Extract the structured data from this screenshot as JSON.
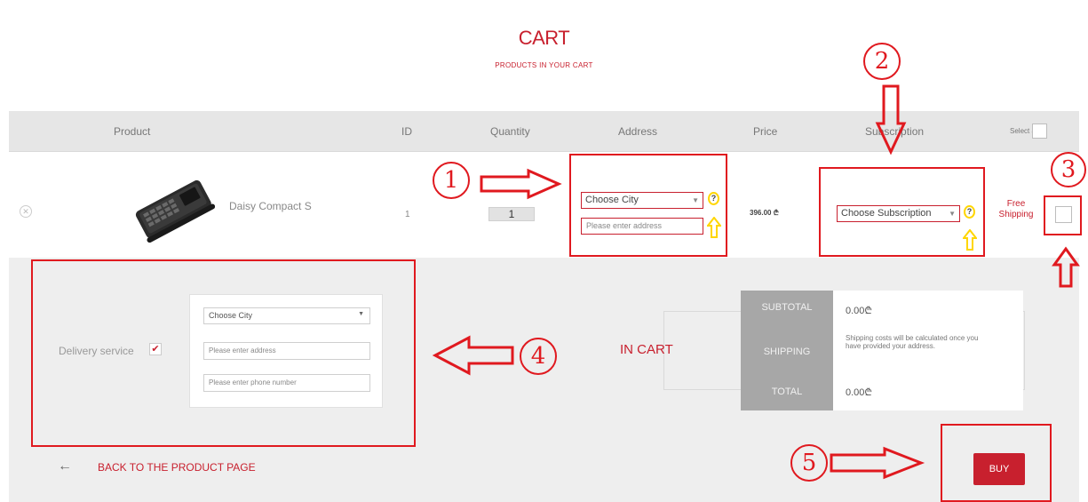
{
  "header": {
    "title": "CART",
    "subtitle": "PRODUCTS IN YOUR CART"
  },
  "table": {
    "columns": [
      "Product",
      "ID",
      "Quantity",
      "Address",
      "Price",
      "Subscription"
    ],
    "select_all_label": "Select all"
  },
  "row": {
    "product_name": "Daisy Compact S",
    "id": "1",
    "quantity": "1",
    "address": {
      "city_value": "Choose City",
      "address_placeholder": "Please enter address"
    },
    "price": "396.00 ₾",
    "subscription_value": "Choose Subscription",
    "help_glyph": "?",
    "free_shipping_label": "Free Shipping"
  },
  "delivery": {
    "label": "Delivery service",
    "city_value": "Choose City",
    "address_placeholder": "Please enter address",
    "phone_placeholder": "Please enter phone number"
  },
  "totals": {
    "in_cart_label": "IN CART",
    "subtotal_label": "SUBTOTAL",
    "subtotal_value": "0.00₾",
    "shipping_label": "SHIPPING",
    "shipping_note": "Shipping costs will be calculated once you have provided your address.",
    "total_label": "TOTAL",
    "total_value": "0.00₾"
  },
  "footer": {
    "back_label": "BACK TO THE PRODUCT PAGE",
    "buy_label": "BUY"
  },
  "annotations": {
    "numbers": [
      "1",
      "2",
      "3",
      "4",
      "5"
    ],
    "color": "#e0191f",
    "highlight_color": "#ffd600"
  },
  "colors": {
    "brand_red": "#c8202e",
    "header_bg": "#e6e6e6",
    "lower_bg": "#eeeeee",
    "totals_grey": "#a7a7a7"
  }
}
